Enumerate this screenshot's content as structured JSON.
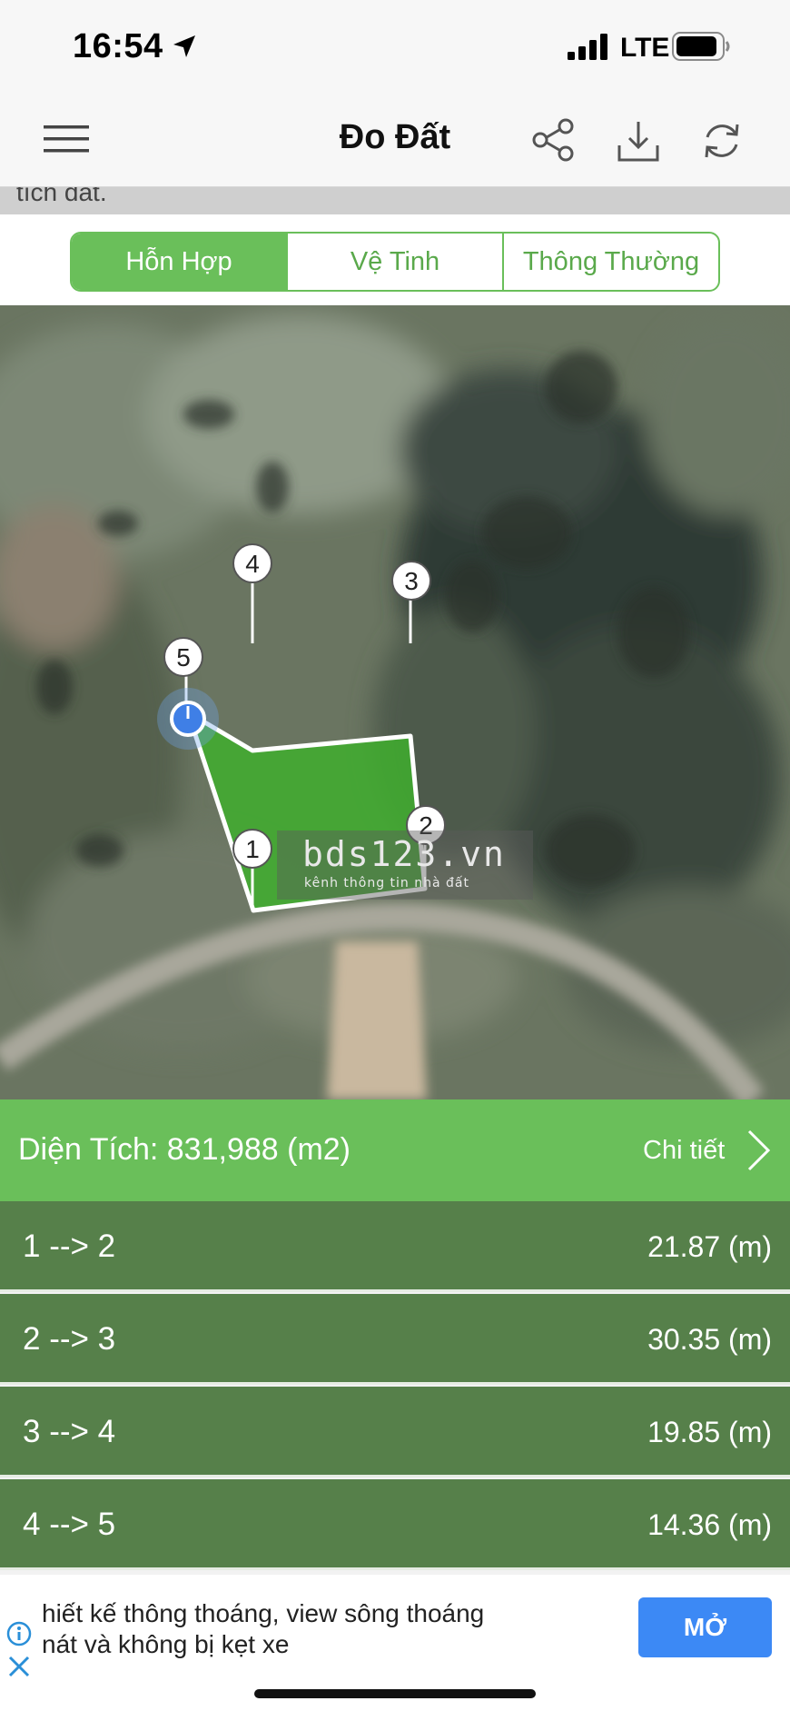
{
  "status_bar": {
    "time": "16:54",
    "network": "LTE"
  },
  "nav": {
    "title": "Đo Đất",
    "icons": [
      "menu-icon",
      "share-icon",
      "download-icon",
      "refresh-icon"
    ]
  },
  "partial_text": "tích đất.",
  "map_type_tabs": [
    {
      "label": "Hỗn Hợp",
      "active": true
    },
    {
      "label": "Vệ Tinh",
      "active": false
    },
    {
      "label": "Thông Thường",
      "active": false
    }
  ],
  "map": {
    "markers": [
      "1",
      "2",
      "3",
      "4",
      "5"
    ],
    "watermark": {
      "logo": "bds123.vn",
      "tagline": "kênh thông tin nhà đất"
    },
    "polygon_color": "#3fae2e"
  },
  "area": {
    "label": "Diện Tích: 831,988 (m2)",
    "detail": "Chi tiết"
  },
  "segments": [
    {
      "from_to": "1 --> 2",
      "distance": "21.87 (m)"
    },
    {
      "from_to": "2 --> 3",
      "distance": "30.35 (m)"
    },
    {
      "from_to": "3 --> 4",
      "distance": "19.85 (m)"
    },
    {
      "from_to": "4 --> 5",
      "distance": "14.36 (m)"
    }
  ],
  "ad": {
    "line1": "hiết kế thông thoáng, view sông thoáng",
    "line2": "nát và không bị kẹt xe",
    "button": "MỞ"
  },
  "colors": {
    "accent": "#6abf5a",
    "row": "#56804a",
    "button": "#3c89f5"
  }
}
